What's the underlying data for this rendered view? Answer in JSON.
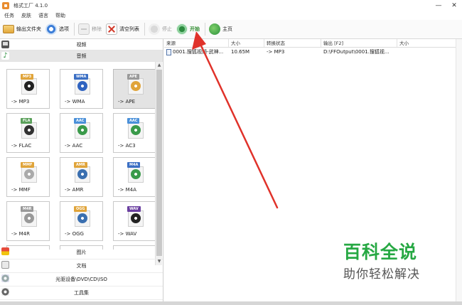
{
  "window": {
    "title": "格式工厂 4.1.0",
    "minimize": "—",
    "close": "✕"
  },
  "menu": [
    "任务",
    "皮肤",
    "语言",
    "帮助"
  ],
  "toolbar": {
    "output_folder": "输出文件夹",
    "options": "选项",
    "remove": "移除",
    "clear_list": "清空列表",
    "stop": "停止",
    "start": "开始",
    "home": "主页"
  },
  "categories": {
    "video": "视频",
    "audio": "音频",
    "image": "图片",
    "document": "文档",
    "disc": "光驱设备\\DVD\\CD\\ISO",
    "tools": "工具集"
  },
  "formats": [
    {
      "badge": "MP3",
      "label": "-> MP3",
      "color": "#e0a43a",
      "glyph": "#222222"
    },
    {
      "badge": "WMA",
      "label": "-> WMA",
      "color": "#3b6fc4",
      "glyph": "#2f63c0"
    },
    {
      "badge": "APE",
      "label": "-> APE",
      "color": "#999999",
      "glyph": "#e0a43a"
    },
    {
      "badge": "FLA",
      "label": "-> FLAC",
      "color": "#5aa05a",
      "glyph": "#333333"
    },
    {
      "badge": "AAC",
      "label": "-> AAC",
      "color": "#4a90d9",
      "glyph": "#3a9a4a"
    },
    {
      "badge": "AAC",
      "label": "-> AC3",
      "color": "#4a90d9",
      "glyph": "#3a9a4a"
    },
    {
      "badge": "MMF",
      "label": "-> MMF",
      "color": "#e0a43a",
      "glyph": "#aaaaaa"
    },
    {
      "badge": "AMR",
      "label": "-> AMR",
      "color": "#e0a43a",
      "glyph": "#3a6fb0"
    },
    {
      "badge": "M4A",
      "label": "-> M4A",
      "color": "#3b6fc4",
      "glyph": "#3a9a4a"
    },
    {
      "badge": "M4R",
      "label": "-> M4R",
      "color": "#999999",
      "glyph": "#999999"
    },
    {
      "badge": "OGG",
      "label": "-> OGG",
      "color": "#e0a43a",
      "glyph": "#3a6fb0"
    },
    {
      "badge": "WAV",
      "label": "-> WAV",
      "color": "#6a3fa0",
      "glyph": "#222222"
    }
  ],
  "table": {
    "headers": [
      "来源",
      "大小",
      "转换状态",
      "输出 [F2]",
      "大小"
    ],
    "rows": [
      {
        "source": "0001.搜狐视频-武神...",
        "size": "10.65M",
        "status": "-> MP3",
        "output": "D:\\FFOutput\\0001.搜狐视...",
        "out_size": ""
      }
    ]
  },
  "watermark": {
    "title": "百科全说",
    "subtitle": "助你轻松解决"
  },
  "colors": {
    "accent_green": "#26a843",
    "arrow_red": "#e0322a"
  }
}
